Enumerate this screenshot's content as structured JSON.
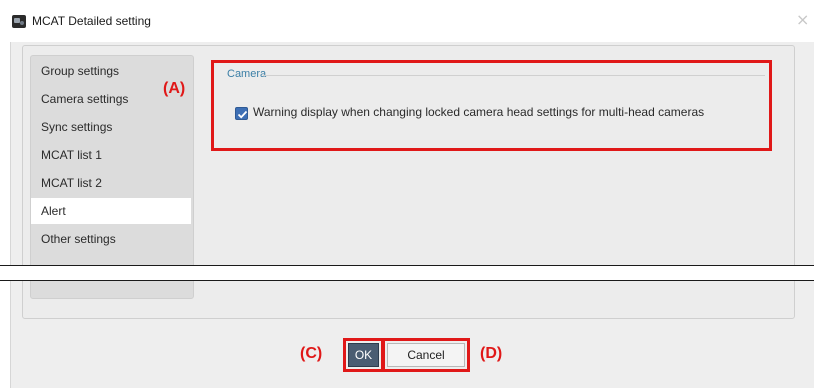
{
  "window": {
    "title": "MCAT Detailed setting",
    "close": "×"
  },
  "sidebar": {
    "items": [
      {
        "label": "Group settings"
      },
      {
        "label": "Camera settings"
      },
      {
        "label": "Sync settings"
      },
      {
        "label": "MCAT list 1"
      },
      {
        "label": "MCAT list 2"
      },
      {
        "label": "Alert",
        "selected": true
      },
      {
        "label": "Other settings"
      }
    ]
  },
  "camera_section": {
    "title": "Camera",
    "warning_checkbox": {
      "checked": true,
      "label": "Warning display when changing locked camera head settings for multi-head cameras"
    }
  },
  "buttons": {
    "ok": "OK",
    "cancel": "Cancel"
  },
  "annotations": {
    "a": "(A)",
    "c": "(C)",
    "d": "(D)",
    "color": "#e01818"
  }
}
